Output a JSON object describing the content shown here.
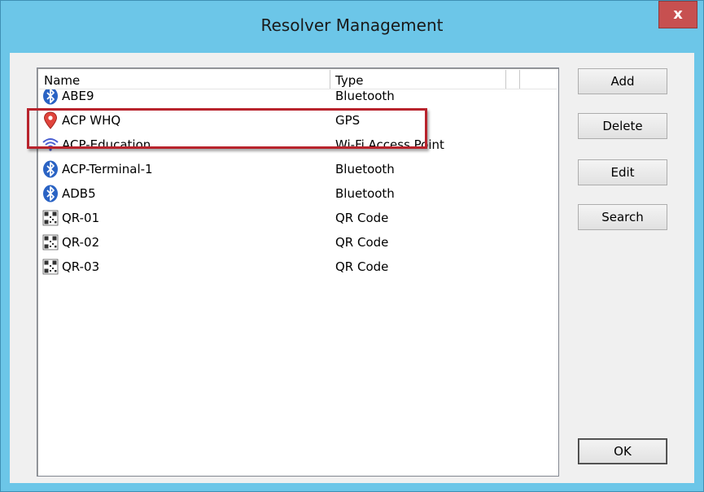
{
  "window": {
    "title": "Resolver Management",
    "close_label": "x"
  },
  "list": {
    "columns": [
      {
        "label": "Name"
      },
      {
        "label": "Type"
      }
    ],
    "rows": [
      {
        "name": "ABE9",
        "type": "Bluetooth",
        "icon": "bluetooth-icon"
      },
      {
        "name": "ACP WHQ",
        "type": "GPS",
        "icon": "map-pin-icon"
      },
      {
        "name": "ACP-Education",
        "type": "Wi-Fi Access Point",
        "icon": "wifi-icon"
      },
      {
        "name": "ACP-Terminal-1",
        "type": "Bluetooth",
        "icon": "bluetooth-icon"
      },
      {
        "name": "ADB5",
        "type": "Bluetooth",
        "icon": "bluetooth-icon"
      },
      {
        "name": "QR-01",
        "type": "QR Code",
        "icon": "qr-code-icon"
      },
      {
        "name": "QR-02",
        "type": "QR Code",
        "icon": "qr-code-icon"
      },
      {
        "name": "QR-03",
        "type": "QR Code",
        "icon": "qr-code-icon"
      }
    ]
  },
  "buttons": {
    "add": "Add",
    "delete": "Delete",
    "edit": "Edit",
    "search": "Search",
    "ok": "OK"
  },
  "colors": {
    "title_bar": "#6cc6e8",
    "close_button": "#c75050",
    "highlight_box": "#b8232c",
    "bluetooth": "#2a63c4",
    "gps_pin": "#e0443c",
    "wifi": "#4a5fd1"
  }
}
